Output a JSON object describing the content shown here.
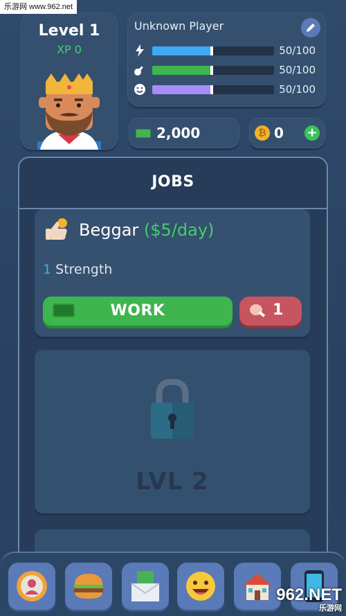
{
  "watermark_top": "乐游网 www.962.net",
  "level_card": {
    "level": "Level 1",
    "xp": "XP 0"
  },
  "player": {
    "name": "Unknown Player",
    "stats": [
      {
        "icon": "lightning-icon",
        "value": "50/100",
        "fraction": 0.5,
        "color": "#3fa9f5"
      },
      {
        "icon": "guitar-icon",
        "value": "50/100",
        "fraction": 0.5,
        "color": "#3fb54d"
      },
      {
        "icon": "smiley-icon",
        "value": "50/100",
        "fraction": 0.5,
        "color": "#a78bfa"
      }
    ]
  },
  "wallet": {
    "cash": "2,000",
    "coins": "0"
  },
  "jobs": {
    "title": "JOBS",
    "job": {
      "name": "Beggar",
      "pay": "($5/day)",
      "req_count": "1",
      "req_label": "Strength",
      "work_label": "WORK",
      "food_count": "1"
    },
    "locked_label": "LVL 2"
  },
  "nav": [
    "profile-icon",
    "burger-icon",
    "mail-money-icon",
    "emoji-icon",
    "house-icon",
    "phone-icon"
  ],
  "watermark_bottom": {
    "main": "962.NET",
    "sub": "乐游网"
  }
}
